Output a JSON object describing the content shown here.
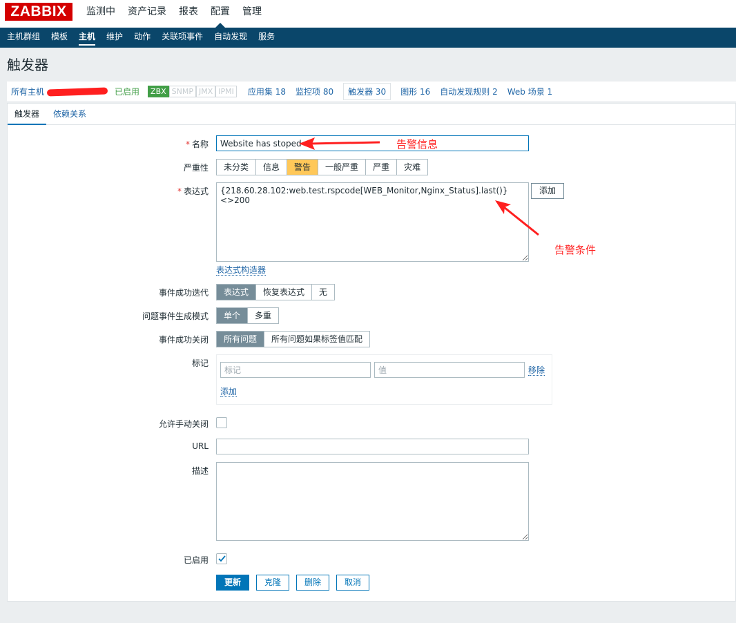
{
  "top": {
    "logo": "ZABBIX",
    "nav": [
      "监测中",
      "资产记录",
      "报表",
      "配置",
      "管理"
    ]
  },
  "subnav": [
    "主机群组",
    "模板",
    "主机",
    "维护",
    "动作",
    "关联项事件",
    "自动发现",
    "服务"
  ],
  "page_title": "触发器",
  "host_row": {
    "all_hosts": "所有主机",
    "enabled": "已启用",
    "badges": [
      "ZBX",
      "SNMP",
      "JMX",
      "IPMI"
    ],
    "links": {
      "apps": "应用集 18",
      "items": "监控项 80",
      "triggers": "触发器 30",
      "graphs": "图形 16",
      "discovery": "自动发现规则 2",
      "web": "Web 场景 1"
    }
  },
  "tabs": [
    "触发器",
    "依赖关系"
  ],
  "form": {
    "name_label": "名称",
    "name_value": "Website has stoped",
    "severity_label": "严重性",
    "severity_options": [
      "未分类",
      "信息",
      "警告",
      "一般严重",
      "严重",
      "灾难"
    ],
    "severity_selected": "警告",
    "expression_label": "表达式",
    "expression_value": "{218.60.28.102:web.test.rspcode[WEB_Monitor,Nginx_Status].last()}<>200",
    "add_label": "添加",
    "expr_builder": "表达式构造器",
    "ok_event_label": "事件成功迭代",
    "ok_event_options": [
      "表达式",
      "恢复表达式",
      "无"
    ],
    "problem_mode_label": "问题事件生成模式",
    "problem_mode_options": [
      "单个",
      "多重"
    ],
    "ok_close_label": "事件成功关闭",
    "ok_close_options": [
      "所有问题",
      "所有问题如果标签值匹配"
    ],
    "tags_label": "标记",
    "tag_placeholder": "标记",
    "value_placeholder": "值",
    "remove_label": "移除",
    "tag_add_label": "添加",
    "manual_close_label": "允许手动关闭",
    "url_label": "URL",
    "desc_label": "描述",
    "enabled_label": "已启用",
    "enabled_checked": true
  },
  "buttons": {
    "update": "更新",
    "clone": "克隆",
    "delete": "删除",
    "cancel": "取消"
  },
  "annotations": {
    "alert_info": "告警信息",
    "alert_condition": "告警条件"
  },
  "colors": {
    "nav_bg": "#0a466a",
    "logo_red": "#d40000",
    "warning_selected": "#ffc859",
    "primary": "#0275b8",
    "annotation_red": "#ff1f1f"
  }
}
